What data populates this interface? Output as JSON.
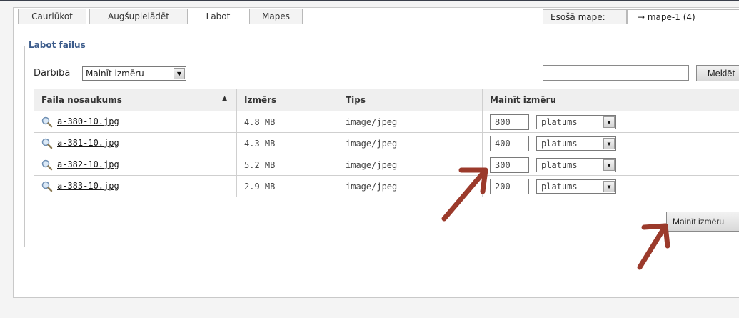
{
  "tabs": [
    "Caurlūkot",
    "Augšupielādēt",
    "Labot",
    "Mapes"
  ],
  "folder": {
    "label": "Esošā mape:",
    "selected": "→ mape-1 (4)"
  },
  "panel": {
    "legend": "Labot failus"
  },
  "action": {
    "label": "Darbība",
    "selected": "Mainīt izmēru"
  },
  "search": {
    "value": "",
    "button": "Meklēt"
  },
  "table": {
    "headers": {
      "name": "Faila nosaukums",
      "size": "Izmērs",
      "type": "Tips",
      "resize": "Mainīt izmēru"
    },
    "rows": [
      {
        "name": "a-380-10.jpg",
        "size": "4.8 MB",
        "type": "image/jpeg",
        "value": "800",
        "dimension": "platums"
      },
      {
        "name": "a-381-10.jpg",
        "size": "4.3 MB",
        "type": "image/jpeg",
        "value": "400",
        "dimension": "platums"
      },
      {
        "name": "a-382-10.jpg",
        "size": "5.2 MB",
        "type": "image/jpeg",
        "value": "300",
        "dimension": "platums"
      },
      {
        "name": "a-383-10.jpg",
        "size": "2.9 MB",
        "type": "image/jpeg",
        "value": "200",
        "dimension": "platums"
      }
    ]
  },
  "resize_button": "Mainīt izmēru",
  "colors": {
    "annotation_arrow": "#9b3a2b",
    "legend": "#3a5a8a"
  },
  "icons": {
    "preview": "magnifier-icon",
    "dropdown": "chevron-down-icon",
    "sort": "sort-up-icon"
  }
}
